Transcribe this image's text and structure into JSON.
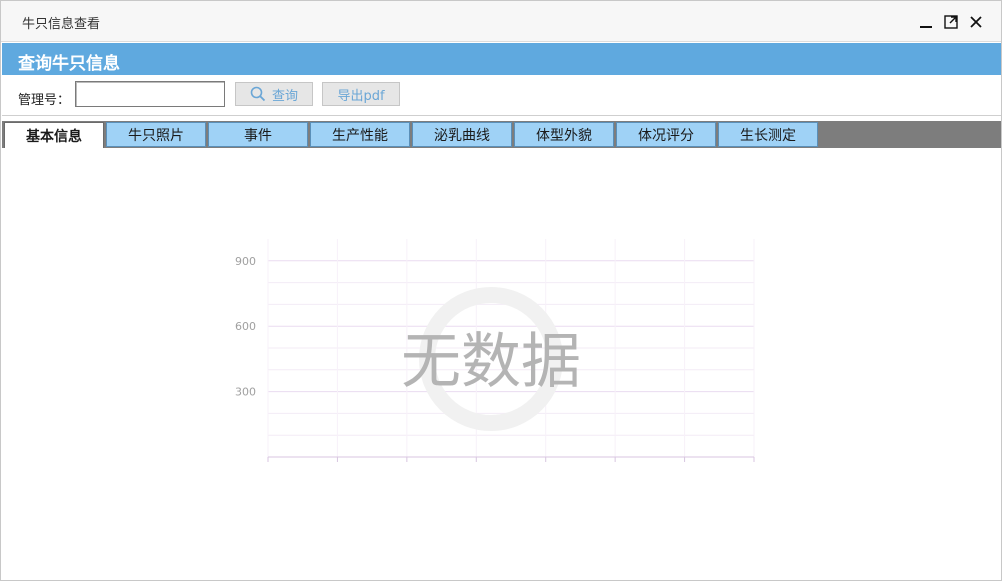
{
  "window": {
    "title": "牛只信息查看",
    "controls": [
      "minimize-icon",
      "maximize-icon",
      "close-icon"
    ]
  },
  "header": {
    "title": "查询牛只信息"
  },
  "toolbar": {
    "id_label": "管理号：",
    "id_value": "",
    "id_placeholder": "",
    "search_label": "查询",
    "export_label": "导出pdf"
  },
  "tabs": [
    {
      "label": "基本信息",
      "active": true
    },
    {
      "label": "牛只照片"
    },
    {
      "label": "事件"
    },
    {
      "label": "生产性能"
    },
    {
      "label": "泌乳曲线"
    },
    {
      "label": "体型外貌"
    },
    {
      "label": "体况评分"
    },
    {
      "label": "生长测定"
    }
  ],
  "empty_state": {
    "text": "无数据"
  },
  "chart_data": {
    "type": "line",
    "y_ticks": [
      "900",
      "600",
      "300"
    ],
    "y_tick_values": [
      900,
      600,
      300
    ],
    "ylim": [
      0,
      1000
    ],
    "grid": true,
    "series": []
  },
  "colors": {
    "header_bg": "#5fa9df",
    "tab_bg": "#9fd2f6",
    "tabbar_bg": "#7d7d7d",
    "button_text": "#6aa6d6"
  }
}
